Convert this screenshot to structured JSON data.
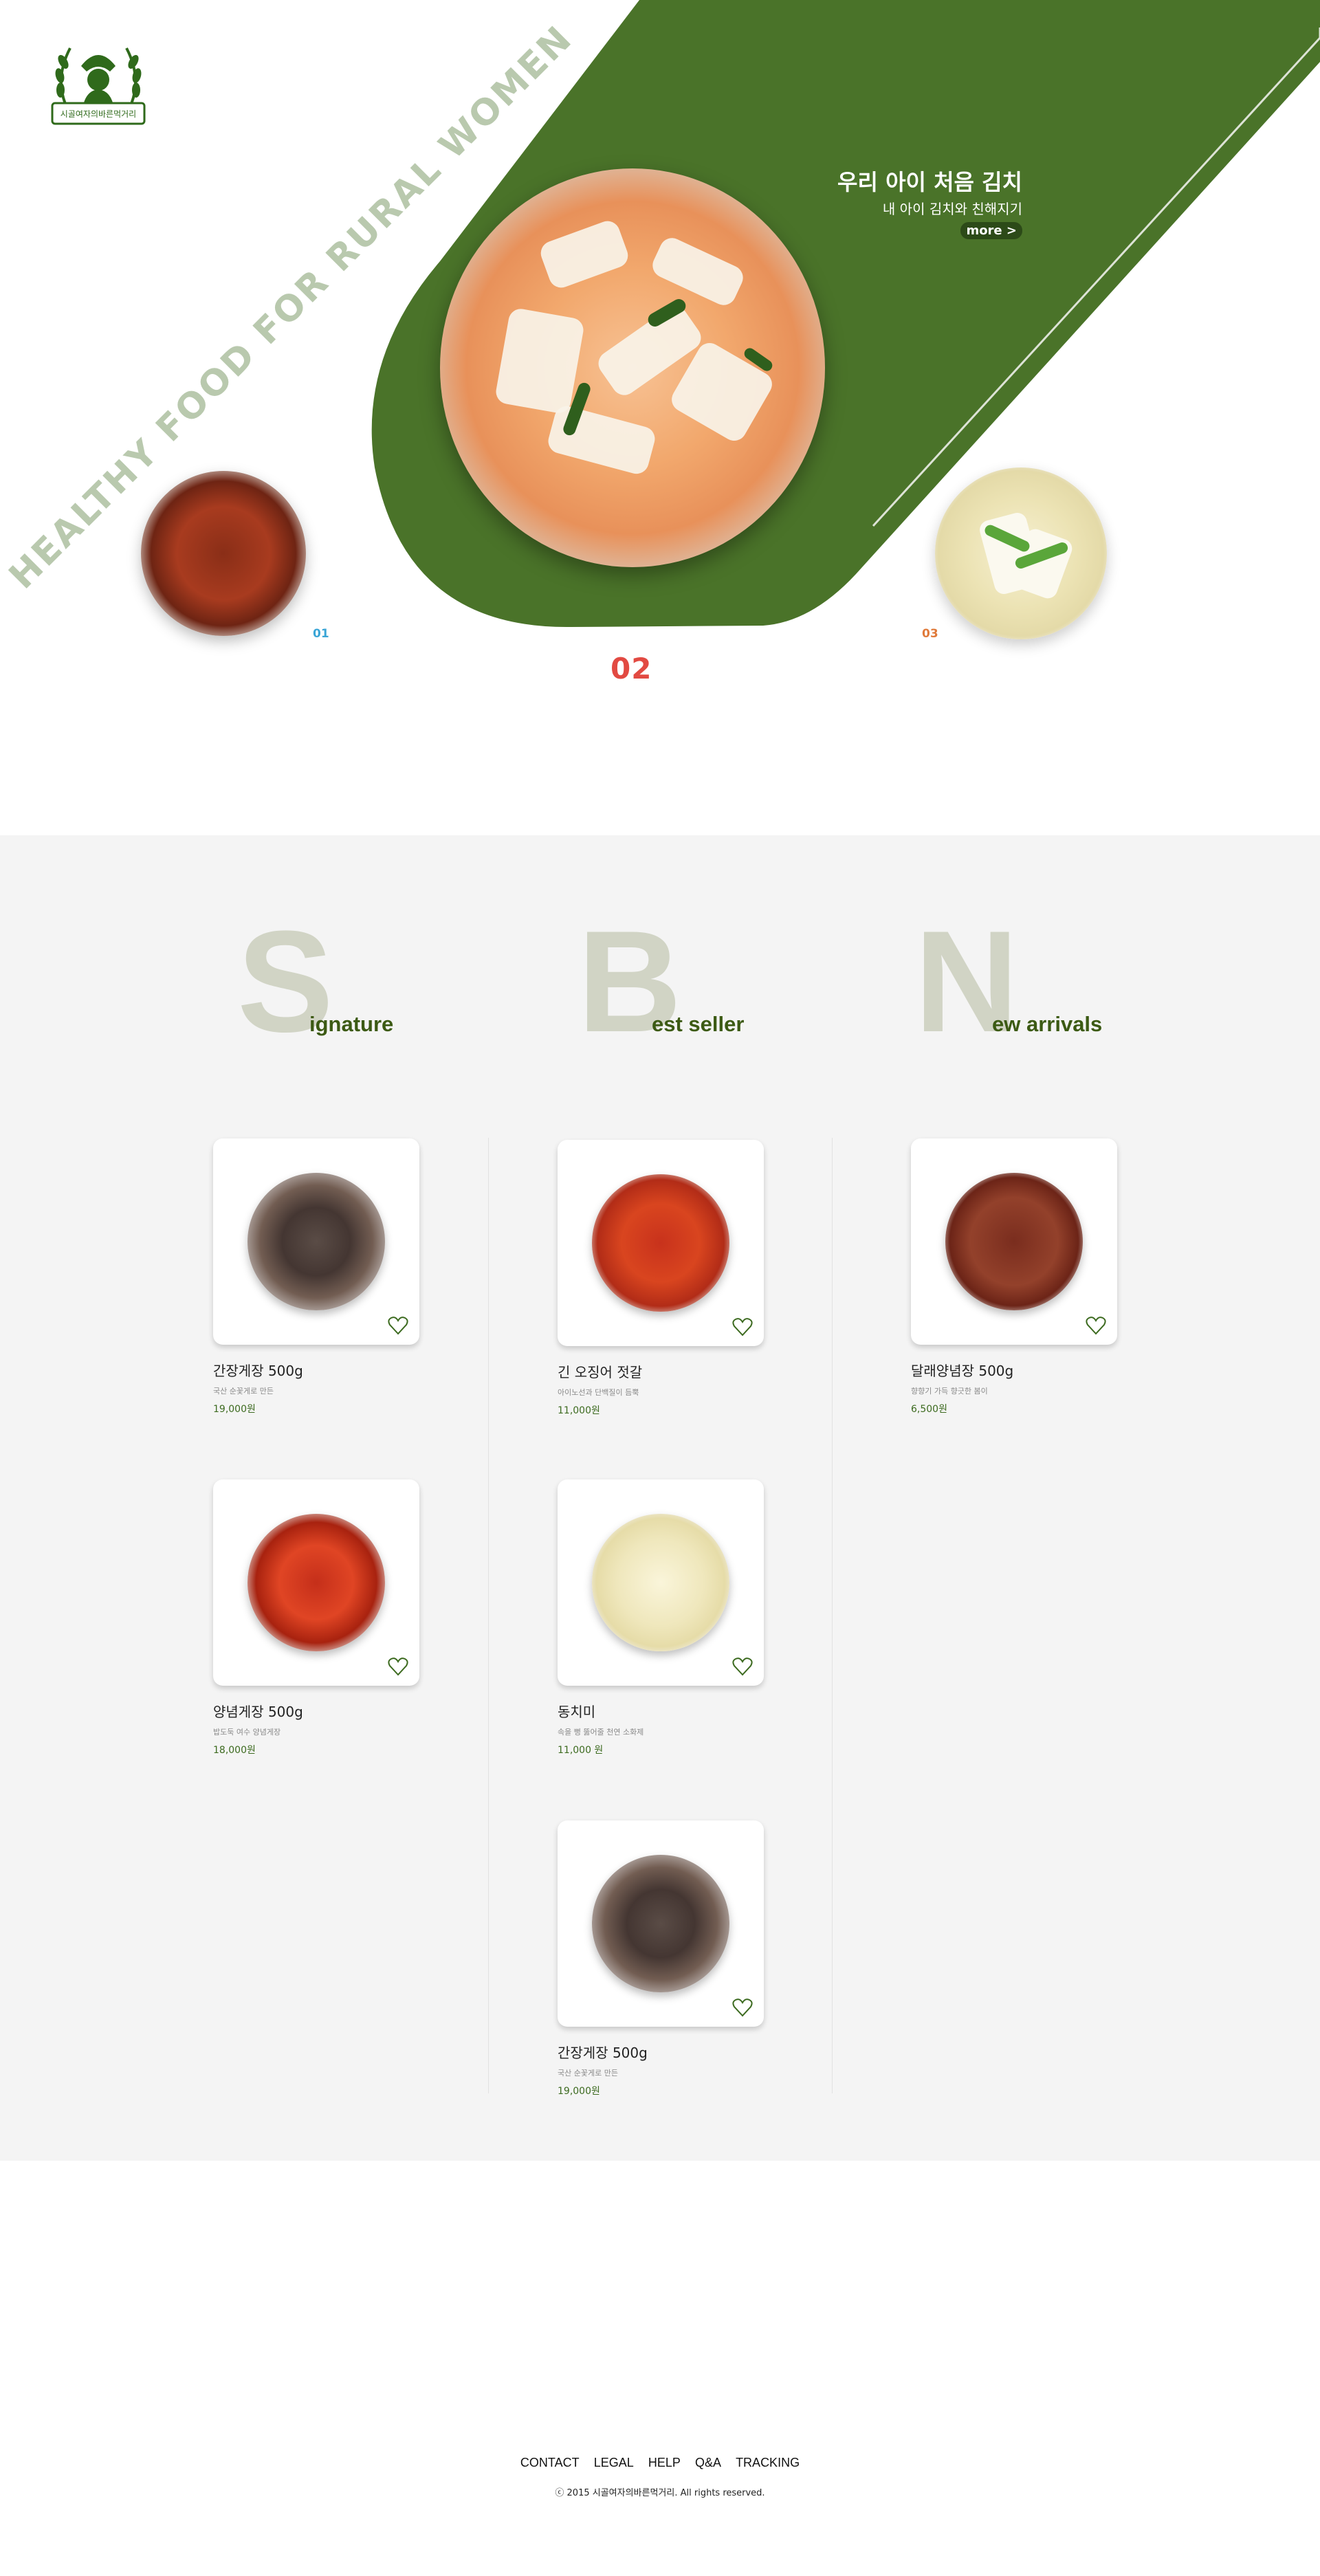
{
  "brand": {
    "logo_text": "시골여자의바른먹거리",
    "slogan": "HEALTHY FOOD FOR RURAL WOMEN",
    "primary_color": "#4a7329",
    "accent_dark": "#2c4a18"
  },
  "hero": {
    "title": "우리 아이 처음 김치",
    "subtitle": "내 아이 김치와 친해지기",
    "more_label": "more >",
    "slides": [
      {
        "number": "01",
        "color": "#3aa5d6"
      },
      {
        "number": "02",
        "color": "#e24a42"
      },
      {
        "number": "03",
        "color": "#e07a3a"
      }
    ]
  },
  "sections": [
    {
      "letter": "S",
      "rest": "ignature"
    },
    {
      "letter": "B",
      "rest": "est seller"
    },
    {
      "letter": "N",
      "rest": "ew arrivals"
    }
  ],
  "products": {
    "signature": [
      {
        "name": "간장게장 500g",
        "desc": "국산 순꽃게로 만든",
        "price": "19,000원",
        "icon": "heart-icon"
      },
      {
        "name": "양념게장 500g",
        "desc": "밥도둑 여수 양념게장",
        "price": "18,000원",
        "icon": "heart-icon"
      }
    ],
    "best_seller": [
      {
        "name": "긴 오징어 젓갈",
        "desc": "아이노선과 단백질이 듬뿍",
        "price": "11,000원",
        "icon": "heart-icon"
      },
      {
        "name": "동치미",
        "desc": "속을 뻥 뚫어줄 천연 소화제",
        "price": "11,000 원",
        "icon": "heart-icon"
      },
      {
        "name": "간장게장 500g",
        "desc": "국산 순꽃게로 만든",
        "price": "19,000원",
        "icon": "heart-icon"
      }
    ],
    "new_arrivals": [
      {
        "name": "달래양념장 500g",
        "desc": "향향기 가득 향긋한 봄이",
        "price": "6,500원",
        "icon": "heart-icon"
      }
    ]
  },
  "footer": {
    "nav": [
      "CONTACT",
      "LEGAL",
      "HELP",
      "Q&A",
      "TRACKING"
    ],
    "copyright": "ⓒ 2015 시골여자의바른먹거리. All rights reserved."
  }
}
